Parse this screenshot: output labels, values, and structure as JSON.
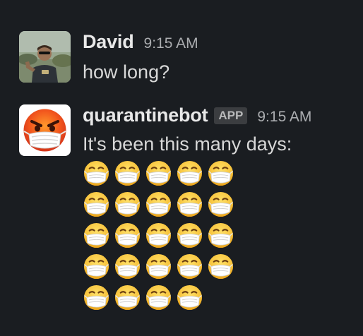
{
  "messages": [
    {
      "sender": "David",
      "time": "9:15 AM",
      "text": "how long?",
      "avatar": "user-photo"
    },
    {
      "sender": "quarantinebot",
      "badge": "APP",
      "time": "9:15 AM",
      "text": "It's been this many days:",
      "avatar": "angry-face-with-mask-icon",
      "emoji": "face-with-medical-mask",
      "emoji_count": 24,
      "emoji_rows": [
        5,
        5,
        5,
        5,
        4
      ]
    }
  ],
  "colors": {
    "background": "#1a1d21",
    "text": "#d1d2d3",
    "badge_bg": "#3b3d40",
    "emoji_yellow": "#f7c23b"
  }
}
